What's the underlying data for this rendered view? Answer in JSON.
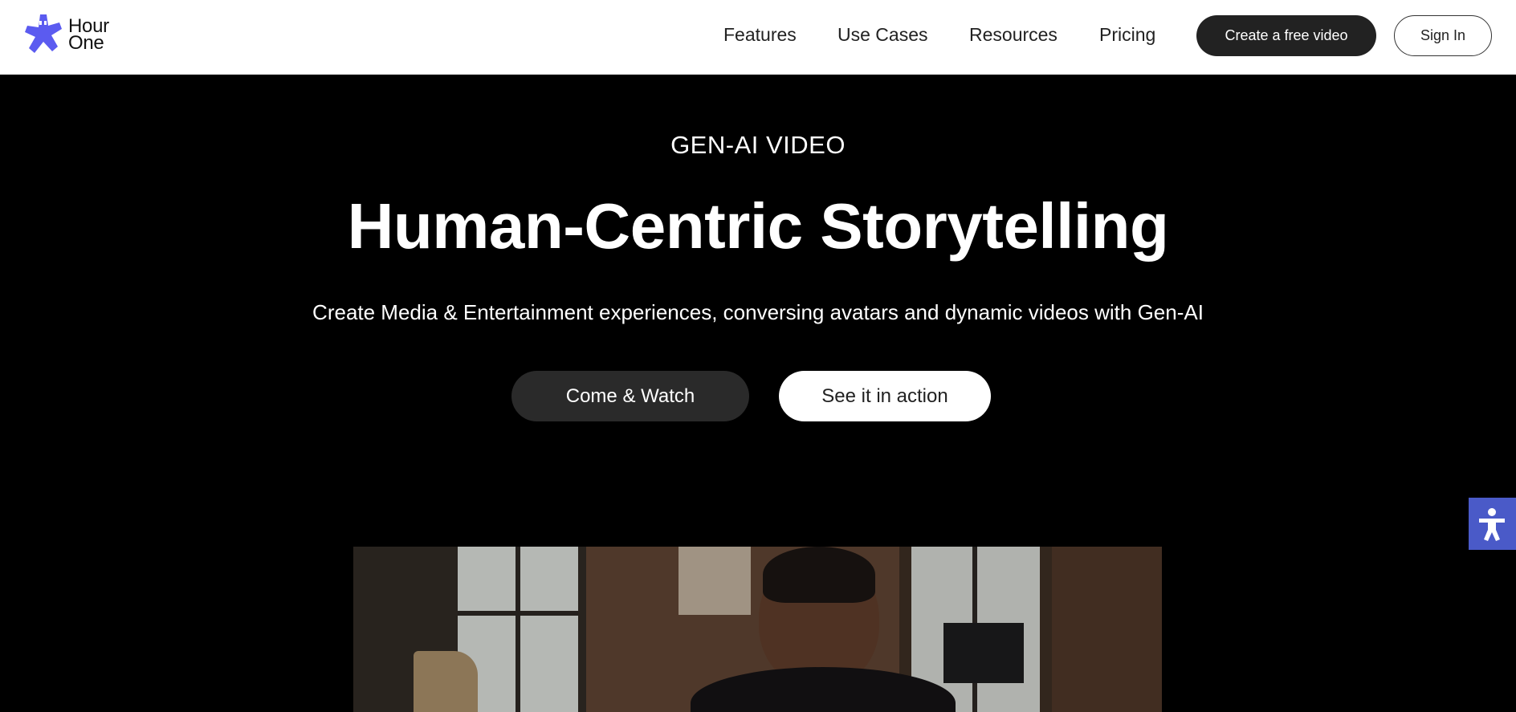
{
  "header": {
    "logo": {
      "line1": "Hour",
      "line2": "One",
      "icon": "star-mascot-icon",
      "color": "#5b5bf0"
    },
    "nav": [
      {
        "label": "Features"
      },
      {
        "label": "Use Cases"
      },
      {
        "label": "Resources"
      },
      {
        "label": "Pricing"
      }
    ],
    "create_label": "Create a free video",
    "signin_label": "Sign In"
  },
  "hero": {
    "eyebrow": "GEN-AI VIDEO",
    "title": "Human-Centric Storytelling",
    "subtitle": "Create Media & Entertainment experiences, conversing avatars and dynamic videos with Gen-AI",
    "primary_cta": "Come & Watch",
    "secondary_cta": "See it in action"
  },
  "accessibility": {
    "icon": "accessibility-icon",
    "color": "#4a5ac8"
  }
}
